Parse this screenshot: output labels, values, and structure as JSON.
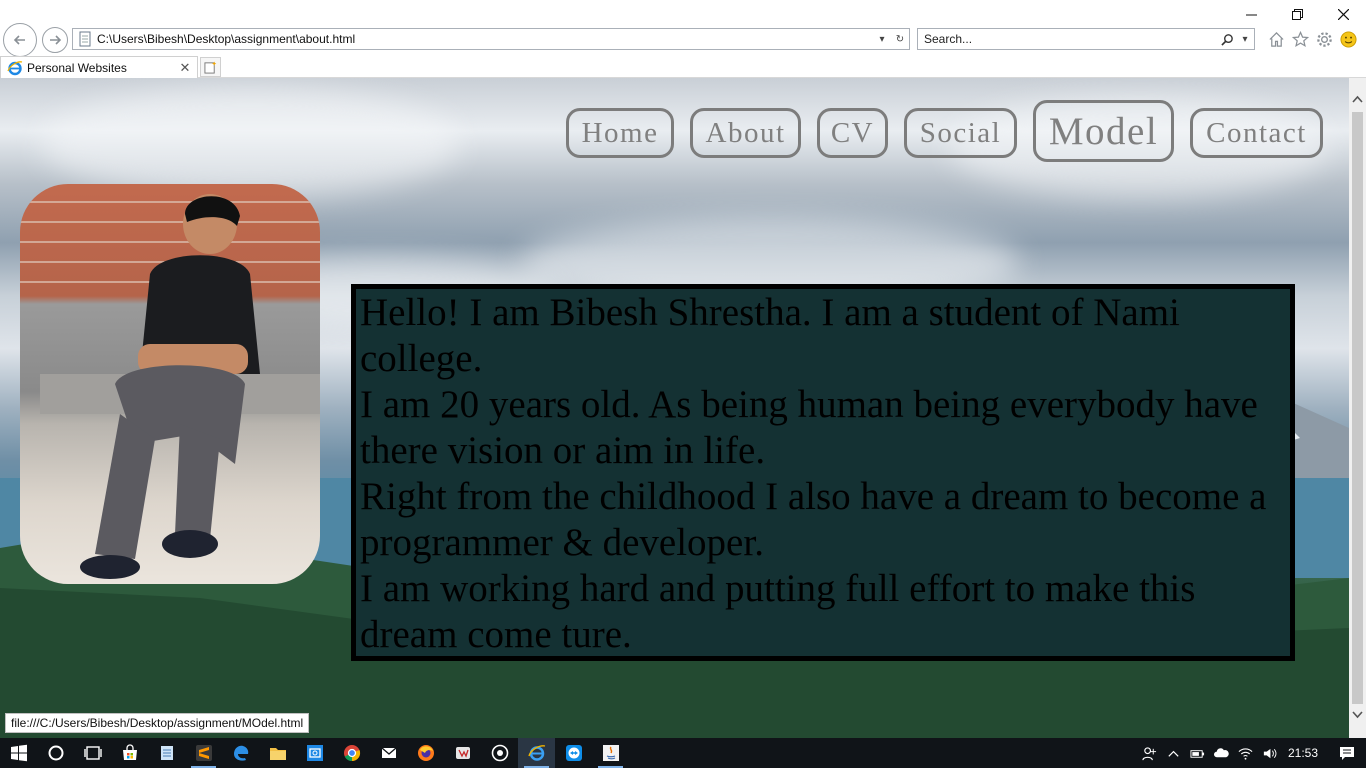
{
  "window": {
    "minimize_label": "—",
    "restore_label": "❐",
    "close_label": "✕"
  },
  "address_bar": {
    "url": "C:\\Users\\Bibesh\\Desktop\\assignment\\about.html",
    "dropdown_glyph": "▾",
    "refresh_glyph": "↻"
  },
  "search_box": {
    "placeholder": "Search...",
    "dropdown_glyph": "▾"
  },
  "tab": {
    "title": "Personal Websites",
    "close_glyph": "✕"
  },
  "page": {
    "menu": [
      {
        "label": "Home",
        "active": false
      },
      {
        "label": "About",
        "active": false
      },
      {
        "label": "CV",
        "active": false
      },
      {
        "label": "Social",
        "active": false
      },
      {
        "label": "Model",
        "active": true
      },
      {
        "label": "Contact",
        "active": false
      }
    ],
    "intro_text": "Hello! I am Bibesh Shrestha. I am a student of Nami college.",
    "paragraph_2": "I am 20 years old. As being human being everybody have there vision or aim in life.",
    "paragraph_3": "Right from the childhood I also have a dream to become a programmer & developer.",
    "paragraph_4": "I am working hard and putting full effort to make this dream come ture.",
    "text_box_color": "#143133"
  },
  "status_bar": {
    "link_url": "file:///C:/Users/Bibesh/Desktop/assignment/MOdel.html"
  },
  "taskbar": {
    "clock": "21:53",
    "icons": [
      "windows-start-icon",
      "cortana-icon",
      "task-view-icon",
      "store-icon",
      "notepad-icon",
      "sublime-icon",
      "edge-icon",
      "file-explorer-icon",
      "photos-icon",
      "chrome-icon",
      "mail-icon",
      "firefox-icon",
      "winamp-icon",
      "media-icon",
      "ie-icon",
      "teamviewer-icon",
      "java-icon"
    ]
  },
  "colors": {
    "menu_border": "#7c7c7c",
    "menu_text": "#808080",
    "taskbar_bg": "#101418"
  }
}
